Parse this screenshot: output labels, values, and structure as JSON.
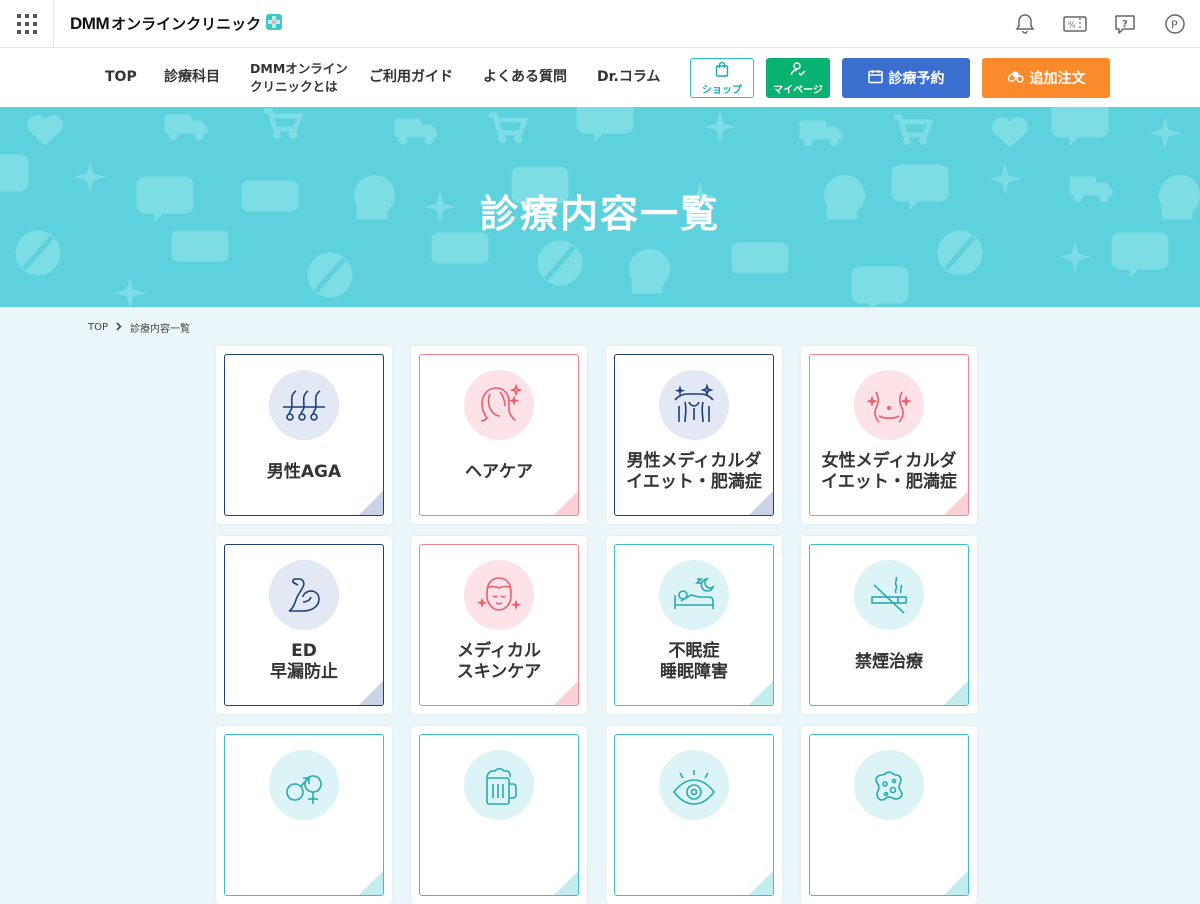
{
  "header": {
    "logo_dmm": "DMM",
    "logo_text": "オンラインクリニック",
    "icons": [
      "grid-menu-icon",
      "bell-icon",
      "coupon-icon",
      "help-icon",
      "point-icon"
    ]
  },
  "nav": {
    "items": [
      {
        "label": "TOP"
      },
      {
        "label": "診療科目"
      },
      {
        "label_line1": "DMMオンライン",
        "label_line2": "クリニックとは"
      },
      {
        "label": "ご利用ガイド"
      },
      {
        "label": "よくある質問"
      },
      {
        "label": "Dr.コラム"
      }
    ],
    "shop_label": "ショップ",
    "mypage_label": "マイページ",
    "reserve_label": "診療予約",
    "order_label": "追加注文"
  },
  "hero": {
    "title": "診療内容一覧"
  },
  "breadcrumb": {
    "home": "TOP",
    "current": "診療内容一覧"
  },
  "cards": [
    {
      "line1": "男性AGA",
      "theme": "navy",
      "icon": "hair-follicle-icon"
    },
    {
      "line1": "ヘアケア",
      "theme": "pink",
      "icon": "female-hair-icon"
    },
    {
      "line1": "男性メディカルダ",
      "line2": "イエット・肥満症",
      "theme": "navy",
      "icon": "male-body-icon"
    },
    {
      "line1": "女性メディカルダ",
      "line2": "イエット・肥満症",
      "theme": "pink",
      "icon": "female-waist-icon"
    },
    {
      "line1": "ED",
      "line2": "早漏防止",
      "theme": "navy",
      "icon": "muscle-arm-icon"
    },
    {
      "line1": "メディカル",
      "line2": "スキンケア",
      "theme": "pink",
      "icon": "face-skincare-icon"
    },
    {
      "line1": "不眠症",
      "line2": "睡眠障害",
      "theme": "teal",
      "icon": "sleep-bed-icon"
    },
    {
      "line1": "禁煙治療",
      "theme": "teal",
      "icon": "no-smoking-icon"
    },
    {
      "line1": "",
      "theme": "teal",
      "icon": "gender-symbols-icon"
    },
    {
      "line1": "",
      "theme": "teal",
      "icon": "beer-mug-icon"
    },
    {
      "line1": "",
      "theme": "teal",
      "icon": "eye-icon"
    },
    {
      "line1": "",
      "theme": "teal",
      "icon": "virus-icon"
    }
  ],
  "colors": {
    "hero_bg": "#5dd1dc",
    "page_bg": "#eaf6f9",
    "navy": "#1c3f7a",
    "pink": "#f0838f",
    "teal": "#3cc0c4",
    "mypage_green": "#08b270",
    "reserve_blue": "#3b6fcf",
    "order_orange": "#fa8a2a"
  }
}
